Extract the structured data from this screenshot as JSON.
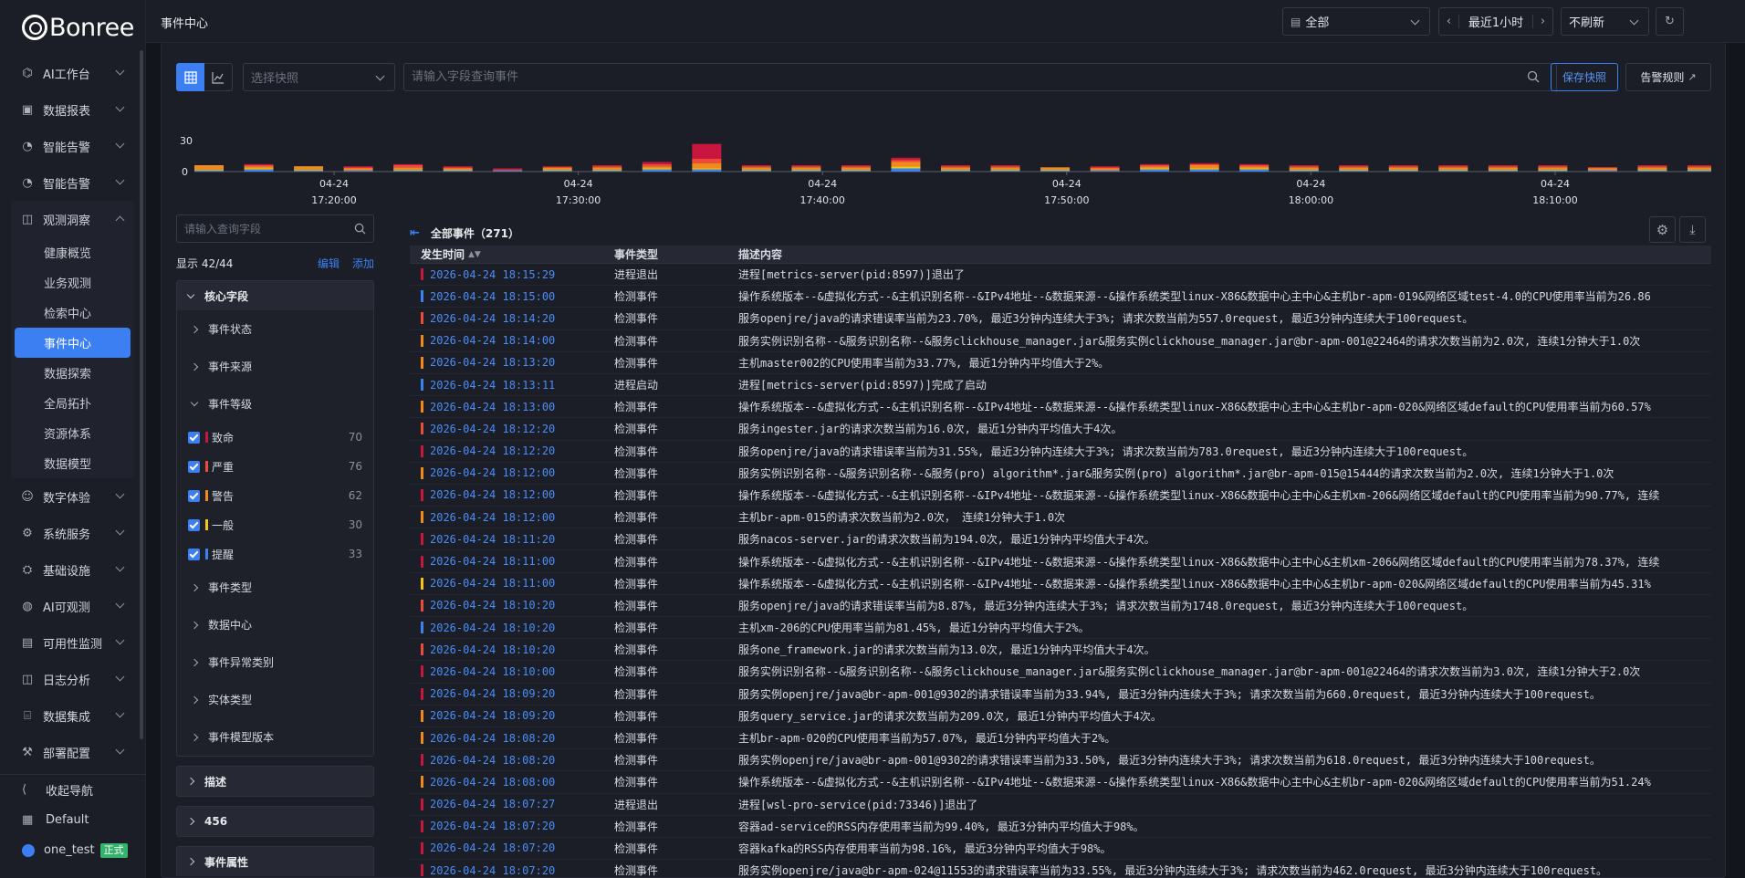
{
  "app": {
    "logo": "Bonree"
  },
  "topbar": {
    "title": "事件中心",
    "scope_value": "全部",
    "time_range": "最近1小时",
    "refresh_value": "不刷新"
  },
  "sidebar": {
    "items": [
      {
        "label": "AI工作台",
        "icon": "ai-workbench-icon"
      },
      {
        "label": "数据报表",
        "icon": "report-icon"
      },
      {
        "label": "智能告警",
        "icon": "alert-icon"
      },
      {
        "label": "智能告警",
        "icon": "alert-icon"
      }
    ],
    "open_group": {
      "label": "观测洞察",
      "children": [
        "健康概览",
        "业务观测",
        "检索中心",
        "事件中心",
        "数据探索",
        "全局拓扑",
        "资源体系",
        "数据模型"
      ],
      "active": "事件中心"
    },
    "items_after": [
      {
        "label": "数字体验",
        "icon": "user-icon"
      },
      {
        "label": "系统服务",
        "icon": "settings-icon"
      },
      {
        "label": "基础设施",
        "icon": "infra-icon"
      },
      {
        "label": "AI可观测",
        "icon": "ai-icon"
      },
      {
        "label": "可用性监测",
        "icon": "monitor-icon"
      },
      {
        "label": "日志分析",
        "icon": "log-icon"
      },
      {
        "label": "数据集成",
        "icon": "integration-icon"
      },
      {
        "label": "部署配置",
        "icon": "deploy-icon"
      }
    ],
    "bottom": {
      "collapse": "收起导航",
      "workspace": "Default",
      "user": "one_test",
      "user_tag": "正式"
    }
  },
  "toolbar": {
    "snapshot_placeholder": "选择快照",
    "query_placeholder": "请输入字段查询事件",
    "save_snapshot": "保存快照",
    "alert_rule": "告警规则"
  },
  "chart_data": {
    "type": "bar",
    "stacked": true,
    "ylim": [
      0,
      30
    ],
    "yticks": [
      "30",
      "0"
    ],
    "xticks": [
      {
        "date": "04-24",
        "time": "17:20:00"
      },
      {
        "date": "04-24",
        "time": "17:30:00"
      },
      {
        "date": "04-24",
        "time": "17:40:00"
      },
      {
        "date": "04-24",
        "time": "17:50:00"
      },
      {
        "date": "04-24",
        "time": "18:00:00"
      },
      {
        "date": "04-24",
        "time": "18:10:00"
      }
    ],
    "colors": {
      "致命": "#c8163f",
      "严重": "#f04a3a",
      "警告": "#f08a1c",
      "一般": "#f5c518",
      "提醒": "#3b82f0"
    },
    "series": [
      {
        "name": "致命",
        "values": [
          0,
          1,
          0,
          1,
          1,
          1,
          1,
          1,
          1,
          2,
          14,
          1,
          1,
          1,
          2,
          1,
          1,
          0,
          1,
          1,
          1,
          1,
          1,
          1,
          1,
          1,
          1,
          1,
          0,
          1,
          1
        ]
      },
      {
        "name": "严重",
        "values": [
          0,
          1,
          0,
          1,
          2,
          1,
          1,
          0,
          1,
          2,
          4,
          1,
          1,
          1,
          2,
          1,
          1,
          0,
          1,
          1,
          1,
          1,
          1,
          1,
          1,
          1,
          1,
          1,
          1,
          1,
          1
        ]
      },
      {
        "name": "警告",
        "values": [
          4,
          2,
          3,
          2,
          2,
          1,
          0,
          2,
          2,
          2,
          5,
          2,
          2,
          2,
          4,
          2,
          2,
          2,
          2,
          2,
          3,
          2,
          2,
          2,
          2,
          2,
          2,
          2,
          2,
          2,
          2
        ]
      },
      {
        "name": "一般",
        "values": [
          1,
          1,
          1,
          0,
          1,
          1,
          0,
          1,
          1,
          1,
          1,
          1,
          1,
          1,
          2,
          1,
          1,
          1,
          0,
          1,
          1,
          1,
          1,
          1,
          1,
          1,
          1,
          1,
          0,
          1,
          1
        ]
      },
      {
        "name": "提醒",
        "values": [
          1,
          2,
          1,
          1,
          1,
          1,
          1,
          1,
          1,
          2,
          2,
          1,
          1,
          1,
          3,
          1,
          1,
          1,
          1,
          2,
          2,
          2,
          1,
          1,
          1,
          1,
          1,
          1,
          1,
          1,
          1
        ]
      }
    ]
  },
  "fields": {
    "search_placeholder": "请输入查询字段",
    "display_count": "显示 42/44",
    "edit": "编辑",
    "add": "添加",
    "core_title": "核心字段",
    "core_items_top": [
      "事件状态",
      "事件来源"
    ],
    "level_title": "事件等级",
    "levels": [
      {
        "name": "致命",
        "count": "70",
        "color": "#c8163f"
      },
      {
        "name": "严重",
        "count": "76",
        "color": "#f04a3a"
      },
      {
        "name": "警告",
        "count": "62",
        "color": "#f08a1c"
      },
      {
        "name": "一般",
        "count": "30",
        "color": "#f5c518"
      },
      {
        "name": "提醒",
        "count": "33",
        "color": "#3b82f0"
      }
    ],
    "core_items_bottom": [
      "事件类型",
      "数据中心",
      "事件异常类别",
      "实体类型",
      "事件模型版本"
    ],
    "groups": [
      "描述",
      "456",
      "事件属性"
    ]
  },
  "events": {
    "title": "全部事件（271）",
    "columns": [
      "发生时间",
      "事件类型",
      "描述内容"
    ],
    "rows": [
      {
        "time": "2026-04-24 18:15:29",
        "level": "#c8163f",
        "type": "进程退出",
        "desc": "进程[metrics-server(pid:8597)]退出了"
      },
      {
        "time": "2026-04-24 18:15:00",
        "level": "#3b82f0",
        "type": "检测事件",
        "desc": "操作系统版本--&虚拟化方式--&主机识别名称--&IPv4地址--&数据来源--&操作系统类型linux-X86&数据中心主中心&主机br-apm-019&网络区域test-4.0的CPU使用率当前为26.86"
      },
      {
        "time": "2026-04-24 18:14:20",
        "level": "#f04a3a",
        "type": "检测事件",
        "desc": "服务openjre/java的请求错误率当前为23.70%, 最近3分钟内连续大于3%; 请求次数当前为557.0request, 最近3分钟内连续大于100request。"
      },
      {
        "time": "2026-04-24 18:14:00",
        "level": "#f08a1c",
        "type": "检测事件",
        "desc": "服务实例识别名称--&服务识别名称--&服务clickhouse_manager.jar&服务实例clickhouse_manager.jar@br-apm-001@22464的请求次数当前为2.0次, 连续1分钟大于1.0次"
      },
      {
        "time": "2026-04-24 18:13:20",
        "level": "#f08a1c",
        "type": "检测事件",
        "desc": "主机master002的CPU使用率当前为33.77%, 最近1分钟内平均值大于2%。"
      },
      {
        "time": "2026-04-24 18:13:11",
        "level": "#3b82f0",
        "type": "进程启动",
        "desc": "进程[metrics-server(pid:8597)]完成了启动"
      },
      {
        "time": "2026-04-24 18:13:00",
        "level": "#f08a1c",
        "type": "检测事件",
        "desc": "操作系统版本--&虚拟化方式--&主机识别名称--&IPv4地址--&数据来源--&操作系统类型linux-X86&数据中心主中心&主机br-apm-020&网络区域default的CPU使用率当前为60.57%"
      },
      {
        "time": "2026-04-24 18:12:20",
        "level": "#f04a3a",
        "type": "检测事件",
        "desc": "服务ingester.jar的请求次数当前为16.0次, 最近1分钟内平均值大于4次。"
      },
      {
        "time": "2026-04-24 18:12:20",
        "level": "#c8163f",
        "type": "检测事件",
        "desc": "服务openjre/java的请求错误率当前为31.55%, 最近3分钟内连续大于3%; 请求次数当前为783.0request, 最近3分钟内连续大于100request。"
      },
      {
        "time": "2026-04-24 18:12:00",
        "level": "#f08a1c",
        "type": "检测事件",
        "desc": "服务实例识别名称--&服务识别名称--&服务(pro) algorithm*.jar&服务实例(pro) algorithm*.jar@br-apm-015@15444的请求次数当前为2.0次, 连续1分钟大于1.0次"
      },
      {
        "time": "2026-04-24 18:12:00",
        "level": "#c8163f",
        "type": "检测事件",
        "desc": "操作系统版本--&虚拟化方式--&主机识别名称--&IPv4地址--&数据来源--&操作系统类型linux-X86&数据中心主中心&主机xm-206&网络区域default的CPU使用率当前为90.77%, 连续"
      },
      {
        "time": "2026-04-24 18:12:00",
        "level": "#f08a1c",
        "type": "检测事件",
        "desc": "主机br-apm-015的请求次数当前为2.0次， 连续1分钟大于1.0次"
      },
      {
        "time": "2026-04-24 18:11:20",
        "level": "#c8163f",
        "type": "检测事件",
        "desc": "服务nacos-server.jar的请求次数当前为194.0次, 最近1分钟内平均值大于4次。"
      },
      {
        "time": "2026-04-24 18:11:00",
        "level": "#c8163f",
        "type": "检测事件",
        "desc": "操作系统版本--&虚拟化方式--&主机识别名称--&IPv4地址--&数据来源--&操作系统类型linux-X86&数据中心主中心&主机xm-206&网络区域default的CPU使用率当前为78.37%, 连续"
      },
      {
        "time": "2026-04-24 18:11:00",
        "level": "#f5c518",
        "type": "检测事件",
        "desc": "操作系统版本--&虚拟化方式--&主机识别名称--&IPv4地址--&数据来源--&操作系统类型linux-X86&数据中心主中心&主机br-apm-020&网络区域default的CPU使用率当前为45.31%"
      },
      {
        "time": "2026-04-24 18:10:20",
        "level": "#f04a3a",
        "type": "检测事件",
        "desc": "服务openjre/java的请求错误率当前为8.87%, 最近3分钟内连续大于3%; 请求次数当前为1748.0request, 最近3分钟内连续大于100request。"
      },
      {
        "time": "2026-04-24 18:10:20",
        "level": "#3b82f0",
        "type": "检测事件",
        "desc": "主机xm-206的CPU使用率当前为81.45%, 最近1分钟内平均值大于2%。"
      },
      {
        "time": "2026-04-24 18:10:20",
        "level": "#f04a3a",
        "type": "检测事件",
        "desc": "服务one_framework.jar的请求次数当前为13.0次, 最近1分钟内平均值大于4次。"
      },
      {
        "time": "2026-04-24 18:10:00",
        "level": "#c8163f",
        "type": "检测事件",
        "desc": "服务实例识别名称--&服务识别名称--&服务clickhouse_manager.jar&服务实例clickhouse_manager.jar@br-apm-001@22464的请求次数当前为3.0次, 连续1分钟大于2.0次"
      },
      {
        "time": "2026-04-24 18:09:20",
        "level": "#c8163f",
        "type": "检测事件",
        "desc": "服务实例openjre/java@br-apm-001@9302的请求错误率当前为33.94%, 最近3分钟内连续大于3%; 请求次数当前为660.0request, 最近3分钟内连续大于100request。"
      },
      {
        "time": "2026-04-24 18:09:20",
        "level": "#f08a1c",
        "type": "检测事件",
        "desc": "服务query_service.jar的请求次数当前为209.0次, 最近1分钟内平均值大于4次。"
      },
      {
        "time": "2026-04-24 18:08:20",
        "level": "#f08a1c",
        "type": "检测事件",
        "desc": "主机br-apm-020的CPU使用率当前为57.07%, 最近1分钟内平均值大于2%。"
      },
      {
        "time": "2026-04-24 18:08:20",
        "level": "#c8163f",
        "type": "检测事件",
        "desc": "服务实例openjre/java@br-apm-001@9302的请求错误率当前为33.50%, 最近3分钟内连续大于3%; 请求次数当前为618.0request, 最近3分钟内连续大于100request。"
      },
      {
        "time": "2026-04-24 18:08:00",
        "level": "#f08a1c",
        "type": "检测事件",
        "desc": "操作系统版本--&虚拟化方式--&主机识别名称--&IPv4地址--&数据来源--&操作系统类型linux-X86&数据中心主中心&主机br-apm-020&网络区域default的CPU使用率当前为51.24%"
      },
      {
        "time": "2026-04-24 18:07:27",
        "level": "#c8163f",
        "type": "进程退出",
        "desc": "进程[wsl-pro-service(pid:73346)]退出了"
      },
      {
        "time": "2026-04-24 18:07:20",
        "level": "#c8163f",
        "type": "检测事件",
        "desc": "容器ad-service的RSS内存使用率当前为99.40%, 最近3分钟内平均值大于98%。"
      },
      {
        "time": "2026-04-24 18:07:20",
        "level": "#c8163f",
        "type": "检测事件",
        "desc": "容器kafka的RSS内存使用率当前为98.16%, 最近3分钟内平均值大于98%。"
      },
      {
        "time": "2026-04-24 18:07:20",
        "level": "#c8163f",
        "type": "检测事件",
        "desc": "服务实例openjre/java@br-apm-024@11553的请求错误率当前为33.55%, 最近3分钟内连续大于3%; 请求次数当前为462.0request, 最近3分钟内连续大于100request。"
      }
    ]
  }
}
